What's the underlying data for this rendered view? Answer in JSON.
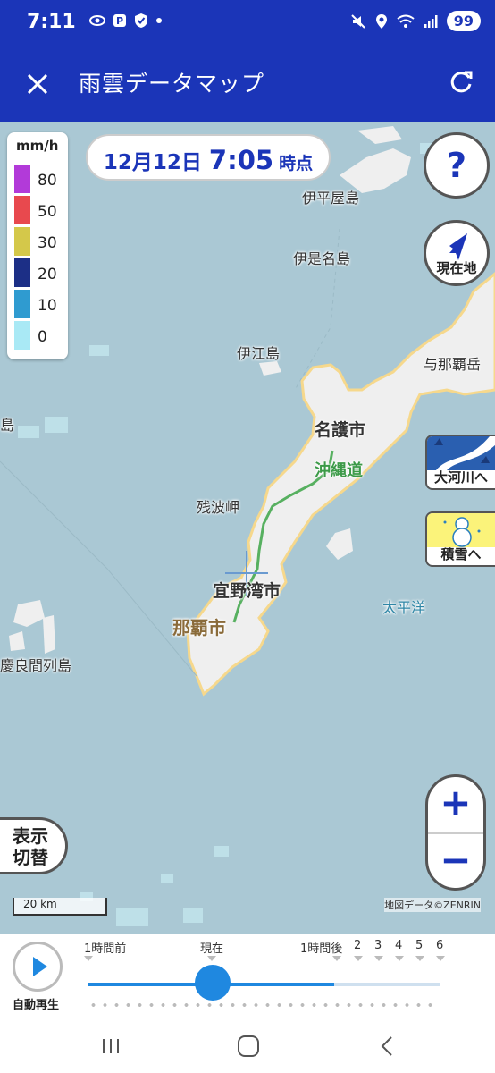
{
  "status_bar": {
    "time": "7:11",
    "battery": "99"
  },
  "app_bar": {
    "title": "雨雲データマップ"
  },
  "legend": {
    "unit": "mm/h",
    "levels": [
      {
        "value": "80",
        "color": "#b23ad9"
      },
      {
        "value": "50",
        "color": "#e8494e"
      },
      {
        "value": "30",
        "color": "#d4c84a"
      },
      {
        "value": "20",
        "color": "#1c2f86"
      },
      {
        "value": "10",
        "color": "#2f9bd0"
      },
      {
        "value": "0",
        "color": "#a9e9f5"
      }
    ]
  },
  "time_pill": {
    "date": "12月12日",
    "time": "7:05",
    "suffix": "時点"
  },
  "map_buttons": {
    "help": "?",
    "location": "現在地",
    "river": "大河川へ",
    "snow": "積雪へ",
    "zoom_in": "+",
    "zoom_out": "−",
    "display_toggle_line1": "表示",
    "display_toggle_line2": "切替"
  },
  "places": {
    "iheya": "伊平屋島",
    "izena": "伊是名島",
    "ie": "伊江島",
    "yonaha": "与那覇岳",
    "shima_left": "島",
    "nago": "名護市",
    "okinawa_expressway": "沖縄道",
    "zanpa": "残波岬",
    "ginowan": "宜野湾市",
    "naha": "那覇市",
    "pacific": "太平洋",
    "kerama": "慶良間列島"
  },
  "scale": "20 km",
  "attribution": "地図データ©ZENRIN",
  "timeline": {
    "autoplay_label": "自動再生",
    "labels": {
      "before_1h": "1時間前",
      "now": "現在",
      "after_1h": "1時間後",
      "h2": "2",
      "h3": "3",
      "h4": "4",
      "h5": "5",
      "h6": "6"
    }
  },
  "colors": {
    "brand": "#1b35b8",
    "accent": "#1f88e0",
    "sea": "#aac8d4",
    "land": "#efefef",
    "road": "#3c9a48"
  }
}
